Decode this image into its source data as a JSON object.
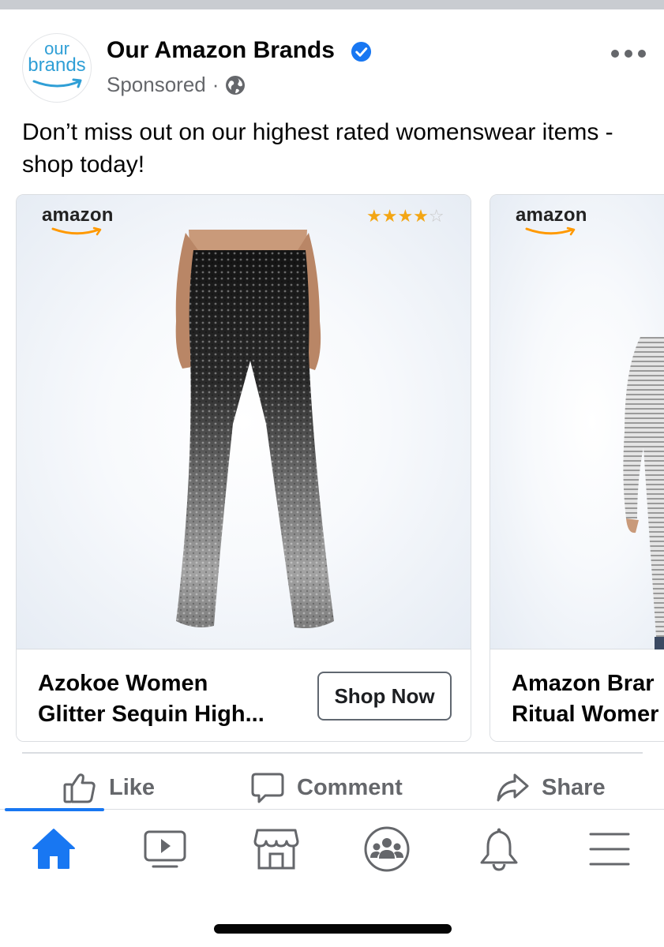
{
  "post": {
    "page_avatar": {
      "line1": "our",
      "line2": "brands"
    },
    "page_name": "Our Amazon Brands",
    "sponsored": "Sponsored",
    "separator": "·",
    "text": "Don’t miss out on our highest rated womenswear items - shop today!"
  },
  "carousel": [
    {
      "brand_logo": "amazon",
      "rating": 4,
      "rating_max": 5,
      "stars_text": {
        "on": "★★★★",
        "off": "☆"
      },
      "title_line1": "Azokoe Women",
      "title_line2": "Glitter Sequin High...",
      "button": "Shop Now",
      "image": "sequin-flare-pants"
    },
    {
      "brand_logo": "amazon",
      "title_line1": "Amazon Brar",
      "title_line2": "Ritual Womer",
      "image": "striped-long-sleeve-top"
    }
  ],
  "actions": {
    "like": "Like",
    "comment": "Comment",
    "share": "Share"
  },
  "tabbar": {
    "active": "home",
    "items": [
      "home-icon",
      "watch-icon",
      "marketplace-icon",
      "groups-icon",
      "notifications-icon",
      "menu-icon"
    ]
  },
  "colors": {
    "accent": "#1877f2",
    "secondary_text": "#65676b",
    "star": "#f3a614",
    "amazon_orange": "#ff9900"
  }
}
